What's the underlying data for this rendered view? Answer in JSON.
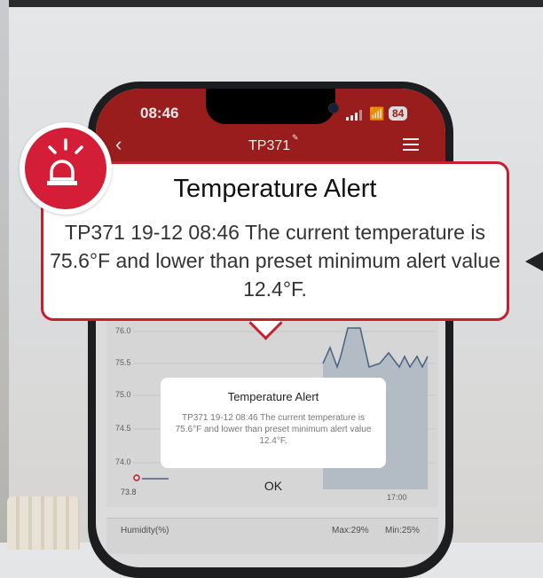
{
  "status_bar": {
    "time": "08:46",
    "battery": "84"
  },
  "app_header": {
    "title": "TP371"
  },
  "chart_data": {
    "type": "line",
    "yticks": [
      "76.0",
      "75.5",
      "75.0",
      "74.5",
      "74.0"
    ],
    "min_label": "73.8",
    "x_label": "17:00",
    "ylim": [
      73.8,
      76.2
    ]
  },
  "humidity": {
    "label": "Humidity(%)",
    "max": "Max:29%",
    "min": "Min:25%"
  },
  "dialog": {
    "title": "Temperature Alert",
    "message": "TP371 19-12 08:46 The current temperature is 75.6°F and lower than preset minimum alert value 12.4°F.",
    "ok": "OK"
  },
  "callout": {
    "title": "Temperature Alert",
    "message": "TP371 19-12 08:46 The current temperature is 75.6°F and lower than preset minimum alert value 12.4°F."
  },
  "colors": {
    "header": "#a62020",
    "alert": "#d41d36"
  }
}
